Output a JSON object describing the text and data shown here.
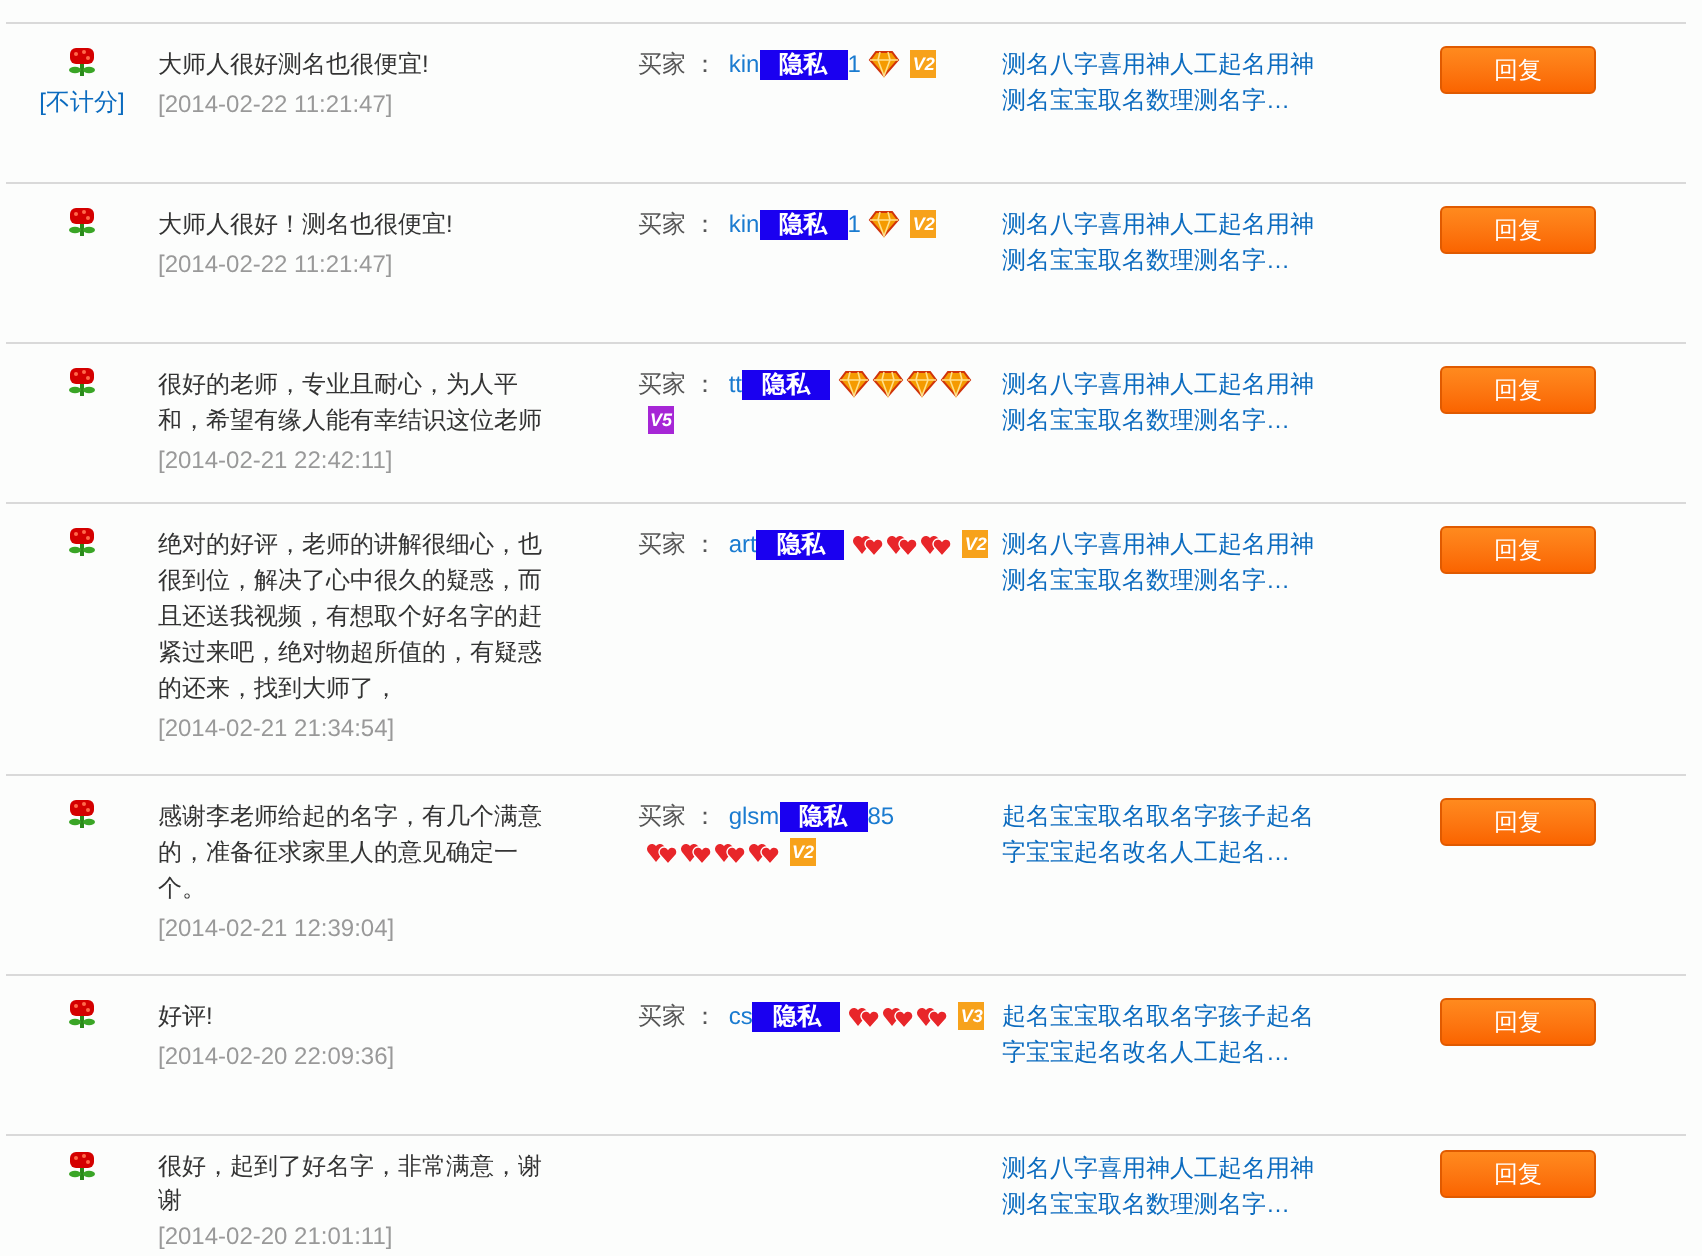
{
  "reviews": [
    {
      "rating": {
        "kind": "flower"
      },
      "note": "[不计分]",
      "comment": "大师人很好测名也很便宜!",
      "date": "[2014-02-22 11:21:47]",
      "buyer_label": "买家 ：",
      "buyer": {
        "prefix": "kin",
        "masked": "隐私",
        "suffix": "1"
      },
      "rank": [
        {
          "kind": "diamond"
        }
      ],
      "vip": {
        "label": "V2",
        "color": "#f7a21b"
      },
      "item": "测名八字喜用神人工起名用神测名宝宝取名数理测名字…",
      "reply_label": "回复"
    },
    {
      "rating": {
        "kind": "flower"
      },
      "comment": "大师人很好！测名也很便宜!",
      "date": "[2014-02-22 11:21:47]",
      "buyer_label": "买家 ：",
      "buyer": {
        "prefix": "kin",
        "masked": "隐私",
        "suffix": "1"
      },
      "rank": [
        {
          "kind": "diamond"
        }
      ],
      "vip": {
        "label": "V2",
        "color": "#f7a21b"
      },
      "item": "测名八字喜用神人工起名用神测名宝宝取名数理测名字…",
      "reply_label": "回复"
    },
    {
      "rating": {
        "kind": "flower"
      },
      "comment": "很好的老师，专业且耐心，为人平和，希望有缘人能有幸结识这位老师",
      "date": "[2014-02-21 22:42:11]",
      "buyer_label": "买家 ：",
      "buyer": {
        "prefix": "tt",
        "masked": "隐私"
      },
      "rank": [
        {
          "kind": "diamond"
        },
        {
          "kind": "diamond"
        },
        {
          "kind": "diamond"
        },
        {
          "kind": "diamond"
        }
      ],
      "vip": {
        "label": "V5",
        "color": "#a626d6"
      },
      "item": "测名八字喜用神人工起名用神测名宝宝取名数理测名字…",
      "reply_label": "回复"
    },
    {
      "rating": {
        "kind": "flower"
      },
      "comment": "绝对的好评，老师的讲解很细心，也很到位，解决了心中很久的疑惑，而且还送我视频，有想取个好名字的赶紧过来吧，绝对物超所值的，有疑惑的还来，找到大师了，",
      "date": "[2014-02-21 21:34:54]",
      "buyer_label": "买家 ：",
      "buyer": {
        "prefix": "art",
        "masked": "隐私"
      },
      "rank": [
        {
          "kind": "heart"
        },
        {
          "kind": "heart"
        },
        {
          "kind": "heart"
        }
      ],
      "vip": {
        "label": "V2",
        "color": "#f7a21b"
      },
      "item": "测名八字喜用神人工起名用神测名宝宝取名数理测名字…",
      "reply_label": "回复"
    },
    {
      "rating": {
        "kind": "flower"
      },
      "comment": "感谢李老师给起的名字，有几个满意的，准备征求家里人的意见确定一个。",
      "date": "[2014-02-21 12:39:04]",
      "buyer_label": "买家 ：",
      "buyer": {
        "prefix": "glsm",
        "masked": "隐私",
        "suffix": "85"
      },
      "rank": [
        {
          "kind": "heart"
        },
        {
          "kind": "heart"
        },
        {
          "kind": "heart"
        },
        {
          "kind": "heart"
        }
      ],
      "vip": {
        "label": "V2",
        "color": "#f7a21b"
      },
      "item": "起名宝宝取名取名字孩子起名字宝宝起名改名人工起名…",
      "reply_label": "回复"
    },
    {
      "rating": {
        "kind": "flower"
      },
      "comment": "好评!",
      "date": "[2014-02-20 22:09:36]",
      "buyer_label": "买家 ：",
      "buyer": {
        "prefix": "cs",
        "masked": "隐私"
      },
      "rank": [
        {
          "kind": "heart"
        },
        {
          "kind": "heart"
        },
        {
          "kind": "heart"
        }
      ],
      "vip": {
        "label": "V3",
        "color": "#f7a21b"
      },
      "item": "起名宝宝取名取名字孩子起名字宝宝起名改名人工起名…",
      "reply_label": "回复"
    },
    {
      "rating": {
        "kind": "flower"
      },
      "comment": "很好，起到了好名字，非常满意，谢谢",
      "date": "[2014-02-20 21:01:11]",
      "item": "测名八字喜用神人工起名用神测名宝宝取名数理测名字…",
      "reply_label": "回复"
    }
  ]
}
